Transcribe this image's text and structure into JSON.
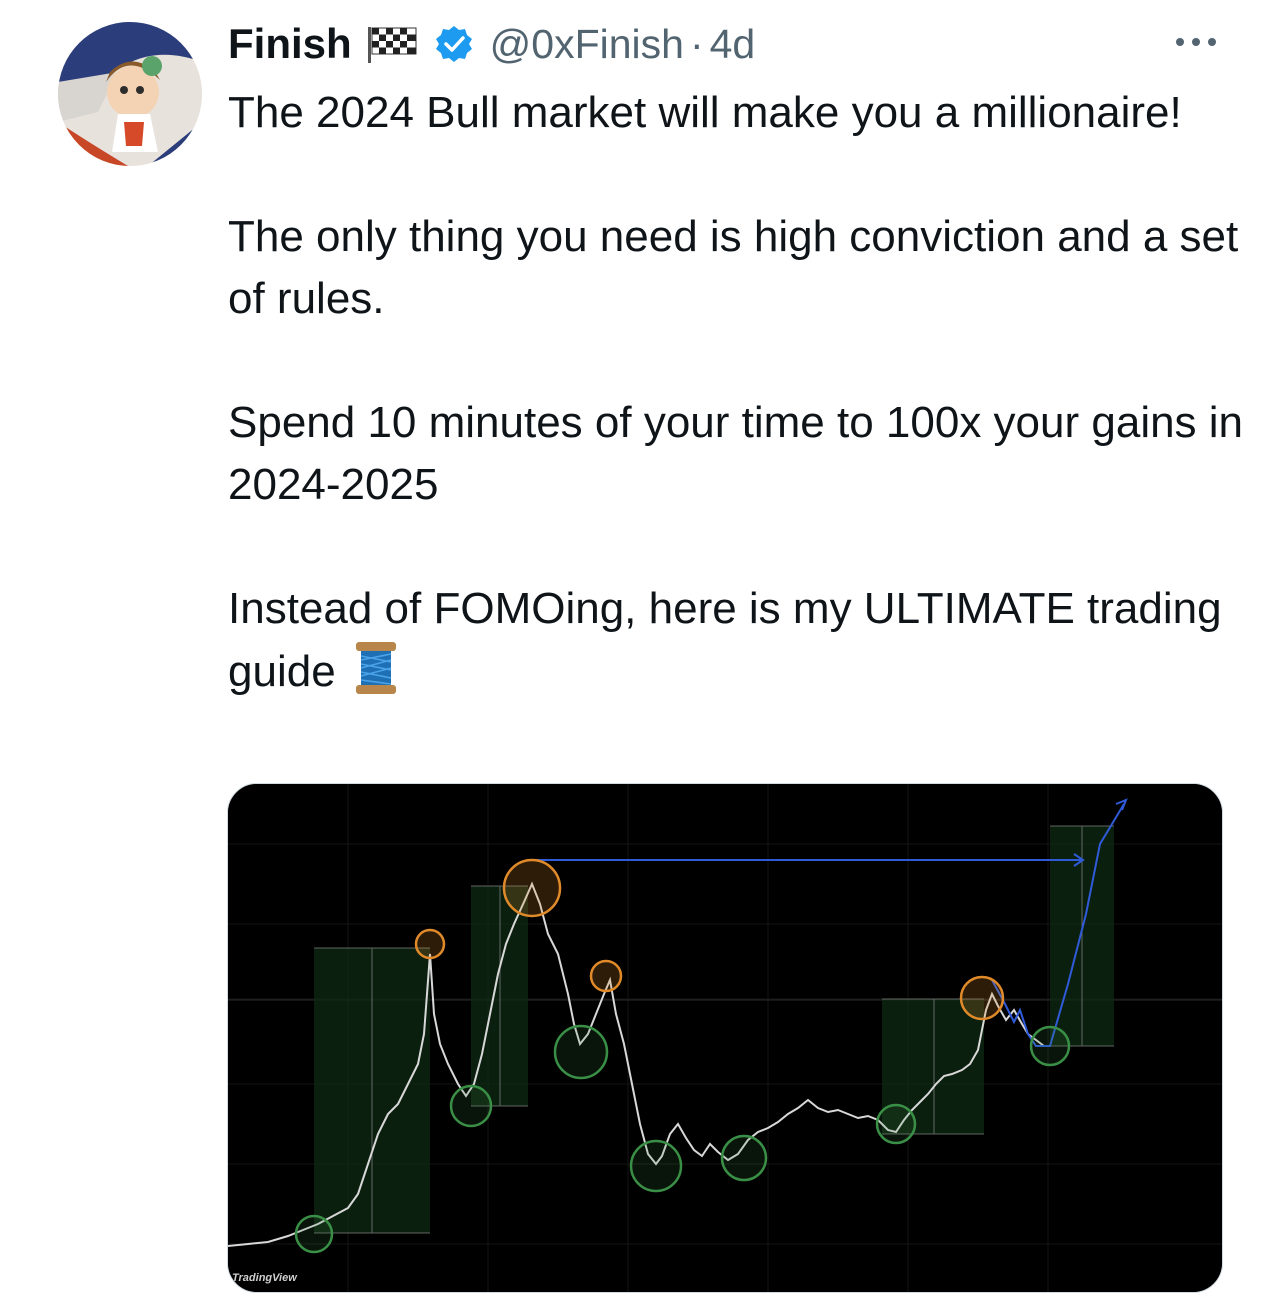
{
  "tweet": {
    "author_name": "Finish",
    "handle": "@0xFinish",
    "separator": "·",
    "time": "4d",
    "paragraphs": [
      "The 2024 Bull market will make you a millionaire!",
      "The only thing you need is high conviction and a set of rules.",
      "Spend 10 minutes of your time to 100x your gains in 2024-2025",
      "Instead of FOMOing, here is my ULTIMATE trading guide"
    ],
    "icons": {
      "name_emoji": "chequered-flag-icon",
      "verified": "verified-badge-icon",
      "more": "more-options-icon",
      "trailing_emoji": "spool-of-thread-icon"
    }
  },
  "media": {
    "watermark": "TradingView"
  },
  "colors": {
    "verified_blue": "#1d9bf0",
    "secondary_text": "#536471",
    "chart_bg": "#000000",
    "arrow_blue": "#2f5bd8",
    "circle_green": "#3a8f46",
    "circle_orange": "#e08a2a"
  }
}
